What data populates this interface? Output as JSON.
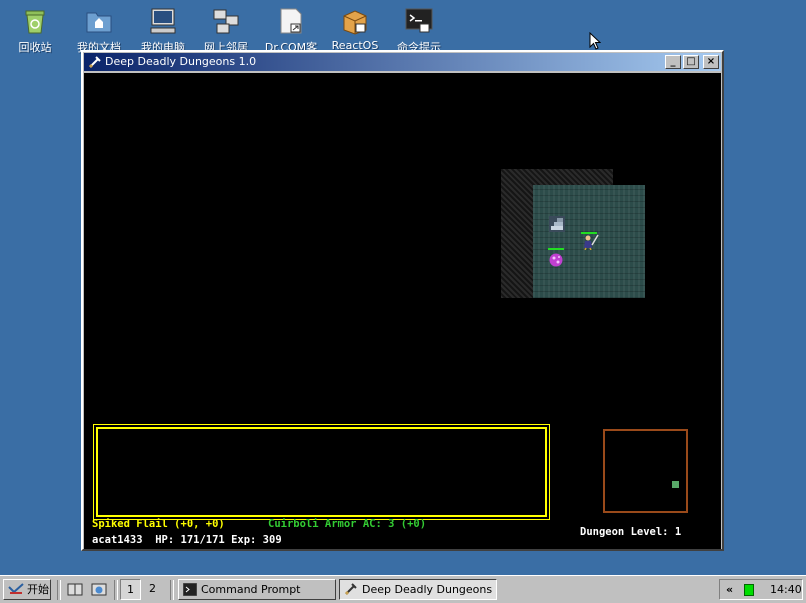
{
  "desktop": {
    "icons": [
      {
        "label": "回收站",
        "icon": "recycle-bin-icon"
      },
      {
        "label": "我的文档",
        "icon": "folder-icon"
      },
      {
        "label": "我的电脑",
        "icon": "computer-icon"
      },
      {
        "label": "网上邻居",
        "icon": "network-icon"
      },
      {
        "label": "Dr.COM客",
        "icon": "shortcut-icon"
      },
      {
        "label": "ReactOS",
        "icon": "box-icon"
      },
      {
        "label": "命令提示",
        "icon": "terminal-icon"
      }
    ]
  },
  "window": {
    "title": "Deep Deadly Dungeons 1.0",
    "controls": {
      "minimize": "_",
      "maximize": "□",
      "close": "×"
    }
  },
  "game": {
    "weapon": "Spiked Flail (+0, +0)",
    "armor": "Cuirboli Armor AC: 3 (+0)",
    "status": "acat1433  HP: 171/171 Exp: 309",
    "dungeon_level": "Dungeon Level: 1",
    "colors": {
      "weapon": "#ffff00",
      "armor": "#33cc33",
      "status": "#ffffff",
      "msg_border": "#ffff00",
      "minimap_border": "#9a4a1a"
    }
  },
  "taskbar": {
    "start_label": "开始",
    "pager": [
      "1",
      "2"
    ],
    "tasks": [
      {
        "label": "Command Prompt",
        "icon": "terminal-icon",
        "active": false
      },
      {
        "label": "Deep Deadly Dungeons ...",
        "icon": "game-icon",
        "active": true
      }
    ],
    "tray_arrow": "«",
    "clock": "14:40"
  }
}
